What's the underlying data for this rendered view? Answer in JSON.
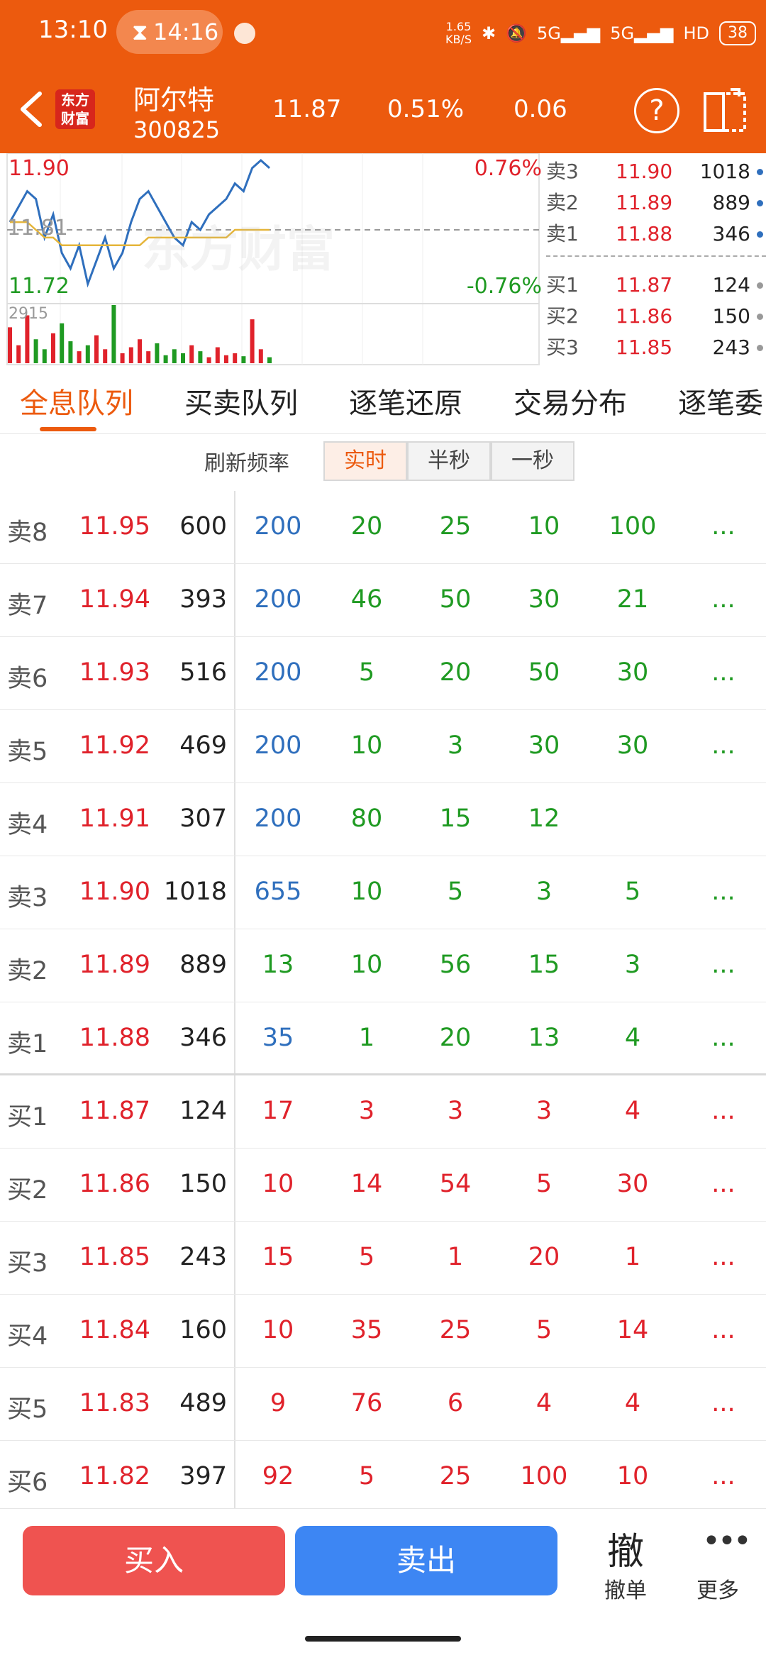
{
  "status_bar": {
    "time": "13:10",
    "pill_time": "14:16",
    "net_speed_value": "1.65",
    "net_speed_unit": "KB/S",
    "signal_labels": [
      "5G",
      "5G"
    ],
    "hd_label": "HD",
    "battery": "38"
  },
  "header": {
    "logo_line1": "东方",
    "logo_line2": "财富",
    "stock_name": "阿尔特",
    "stock_code": "300825",
    "price": "11.87",
    "change_pct": "0.51%",
    "change": "0.06",
    "help_glyph": "?"
  },
  "chart": {
    "high_label": "11.90",
    "high_pct": "0.76%",
    "mid_label": "11.81",
    "low_label": "11.72",
    "low_pct": "-0.76%",
    "vol_label": "2915",
    "watermark": "东方财富",
    "colors": {
      "price_line": "#2f6fbd",
      "avg_line": "#e5b53a",
      "vol_up": "#e0222b",
      "vol_down": "#1f9a22"
    }
  },
  "chart_data": {
    "type": "line",
    "ylim": [
      11.72,
      11.9
    ],
    "series": [
      {
        "values": [
          11.82,
          11.84,
          11.86,
          11.85,
          11.8,
          11.83,
          11.78,
          11.76,
          11.79,
          11.74,
          11.77,
          11.8,
          11.76,
          11.78,
          11.82,
          11.85,
          11.86,
          11.84,
          11.82,
          11.8,
          11.79,
          11.82,
          11.81,
          11.83,
          11.84,
          11.85,
          11.87,
          11.86,
          11.89,
          11.9,
          11.89
        ]
      },
      {
        "values": [
          11.82,
          11.82,
          11.82,
          11.81,
          11.8,
          11.8,
          11.79,
          11.79,
          11.79,
          11.79,
          11.79,
          11.79,
          11.79,
          11.79,
          11.79,
          11.79,
          11.8,
          11.8,
          11.8,
          11.8,
          11.8,
          11.8,
          11.8,
          11.8,
          11.8,
          11.8,
          11.81,
          11.81,
          11.81,
          11.81,
          11.81
        ]
      }
    ],
    "volume": [
      1800,
      900,
      2400,
      1200,
      700,
      1500,
      2000,
      1100,
      600,
      900,
      1400,
      700,
      2915,
      500,
      800,
      1200,
      600,
      1000,
      400,
      700,
      500,
      900,
      600,
      300,
      800,
      400,
      500,
      350,
      2200,
      700,
      300
    ]
  },
  "book": [
    {
      "label": "卖3",
      "price": "11.90",
      "vol": "1018",
      "side": "sell"
    },
    {
      "label": "卖2",
      "price": "11.89",
      "vol": "889",
      "side": "sell"
    },
    {
      "label": "卖1",
      "price": "11.88",
      "vol": "346",
      "side": "sell"
    },
    {
      "label": "买1",
      "price": "11.87",
      "vol": "124",
      "side": "buy"
    },
    {
      "label": "买2",
      "price": "11.86",
      "vol": "150",
      "side": "buy"
    },
    {
      "label": "买3",
      "price": "11.85",
      "vol": "243",
      "side": "buy"
    }
  ],
  "tabs": [
    "全息队列",
    "买卖队列",
    "逐笔还原",
    "交易分布",
    "逐笔委"
  ],
  "refresh": {
    "label": "刷新频率",
    "options": [
      "实时",
      "半秒",
      "一秒"
    ],
    "active": "实时"
  },
  "queue": [
    {
      "label": "卖8",
      "price": "11.95",
      "vol": "600",
      "orders": [
        "200",
        "20",
        "25",
        "10",
        "100"
      ],
      "more": "...",
      "side": "sell"
    },
    {
      "label": "卖7",
      "price": "11.94",
      "vol": "393",
      "orders": [
        "200",
        "46",
        "50",
        "30",
        "21"
      ],
      "more": "...",
      "side": "sell"
    },
    {
      "label": "卖6",
      "price": "11.93",
      "vol": "516",
      "orders": [
        "200",
        "5",
        "20",
        "50",
        "30"
      ],
      "more": "...",
      "side": "sell"
    },
    {
      "label": "卖5",
      "price": "11.92",
      "vol": "469",
      "orders": [
        "200",
        "10",
        "3",
        "30",
        "30"
      ],
      "more": "...",
      "side": "sell"
    },
    {
      "label": "卖4",
      "price": "11.91",
      "vol": "307",
      "orders": [
        "200",
        "80",
        "15",
        "12",
        ""
      ],
      "more": "",
      "side": "sell"
    },
    {
      "label": "卖3",
      "price": "11.90",
      "vol": "1018",
      "orders": [
        "655",
        "10",
        "5",
        "3",
        "5"
      ],
      "more": "...",
      "side": "sell"
    },
    {
      "label": "卖2",
      "price": "11.89",
      "vol": "889",
      "orders": [
        "13",
        "10",
        "56",
        "15",
        "3"
      ],
      "more": "...",
      "side": "sell"
    },
    {
      "label": "卖1",
      "price": "11.88",
      "vol": "346",
      "orders": [
        "35",
        "1",
        "20",
        "13",
        "4"
      ],
      "more": "...",
      "side": "sell"
    },
    {
      "label": "买1",
      "price": "11.87",
      "vol": "124",
      "orders": [
        "17",
        "3",
        "3",
        "3",
        "4"
      ],
      "more": "...",
      "side": "buy"
    },
    {
      "label": "买2",
      "price": "11.86",
      "vol": "150",
      "orders": [
        "10",
        "14",
        "54",
        "5",
        "30"
      ],
      "more": "...",
      "side": "buy"
    },
    {
      "label": "买3",
      "price": "11.85",
      "vol": "243",
      "orders": [
        "15",
        "5",
        "1",
        "20",
        "1"
      ],
      "more": "...",
      "side": "buy"
    },
    {
      "label": "买4",
      "price": "11.84",
      "vol": "160",
      "orders": [
        "10",
        "35",
        "25",
        "5",
        "14"
      ],
      "more": "...",
      "side": "buy"
    },
    {
      "label": "买5",
      "price": "11.83",
      "vol": "489",
      "orders": [
        "9",
        "76",
        "6",
        "4",
        "4"
      ],
      "more": "...",
      "side": "buy"
    },
    {
      "label": "买6",
      "price": "11.82",
      "vol": "397",
      "orders": [
        "92",
        "5",
        "25",
        "100",
        "10"
      ],
      "more": "...",
      "side": "buy"
    }
  ],
  "bottom": {
    "buy": "买入",
    "sell": "卖出",
    "cancel_icon": "撤",
    "cancel": "撤单",
    "more_icon": "•••",
    "more": "更多"
  }
}
